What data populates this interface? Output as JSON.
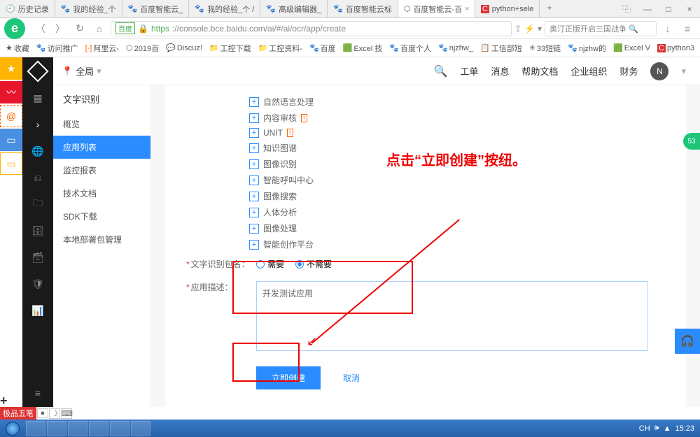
{
  "tabs": [
    {
      "icon": "🕘",
      "label": "历史记录"
    },
    {
      "icon": "🐾",
      "label": "我的经验_个"
    },
    {
      "icon": "🐾",
      "label": "百度智能云_"
    },
    {
      "icon": "🐾",
      "label": "我的经验_个 /"
    },
    {
      "icon": "🐾",
      "label": "高级编辑器_"
    },
    {
      "icon": "🐾",
      "label": "百度智能云标"
    },
    {
      "icon": "⬡",
      "label": "百度智能云-百",
      "active": true
    },
    {
      "icon": "C",
      "label": "python+sele"
    }
  ],
  "url": {
    "prefix": "百度",
    "scheme": "https",
    "rest": "://console.bce.baidu.com/ai/#/ai/ocr/app/create"
  },
  "searchbox": "奥汀正版开启三国战争",
  "bookmarks": [
    "收藏",
    "访问推广",
    "阿里云-",
    "2019百",
    "Discuz!",
    "工控下载",
    "工控资料-",
    "百度",
    "Excel 技",
    "百度个人",
    "njzhw_",
    "工信部短",
    "33短链",
    "njzhw的",
    "Excel V",
    "python3"
  ],
  "location": "全局",
  "topnav": [
    "工单",
    "消息",
    "帮助文档",
    "企业组织",
    "财务"
  ],
  "avatar": "N",
  "menu": {
    "title": "文字识别",
    "items": [
      "概览",
      "应用列表",
      "监控报表",
      "技术文档",
      "SDK下载",
      "本地部署包管理"
    ],
    "activeIndex": 1
  },
  "services": [
    "自然语言处理",
    "内容审核",
    "UNIT",
    "知识图谱",
    "图像识别",
    "智能呼叫中心",
    "图像搜索",
    "人体分析",
    "图像处理",
    "智能创作平台"
  ],
  "form": {
    "pkgLabel": "文字识别包名：",
    "opt1": "需要",
    "opt2": "不需要",
    "descLabel": "应用描述：",
    "descValue": "开发测试应用",
    "submit": "立即创建",
    "cancel": "取消"
  },
  "annotation": "点击“立即创建”按纽。",
  "ime": "极品五笔",
  "tray": {
    "lang": "CH",
    "time": "15:23"
  }
}
